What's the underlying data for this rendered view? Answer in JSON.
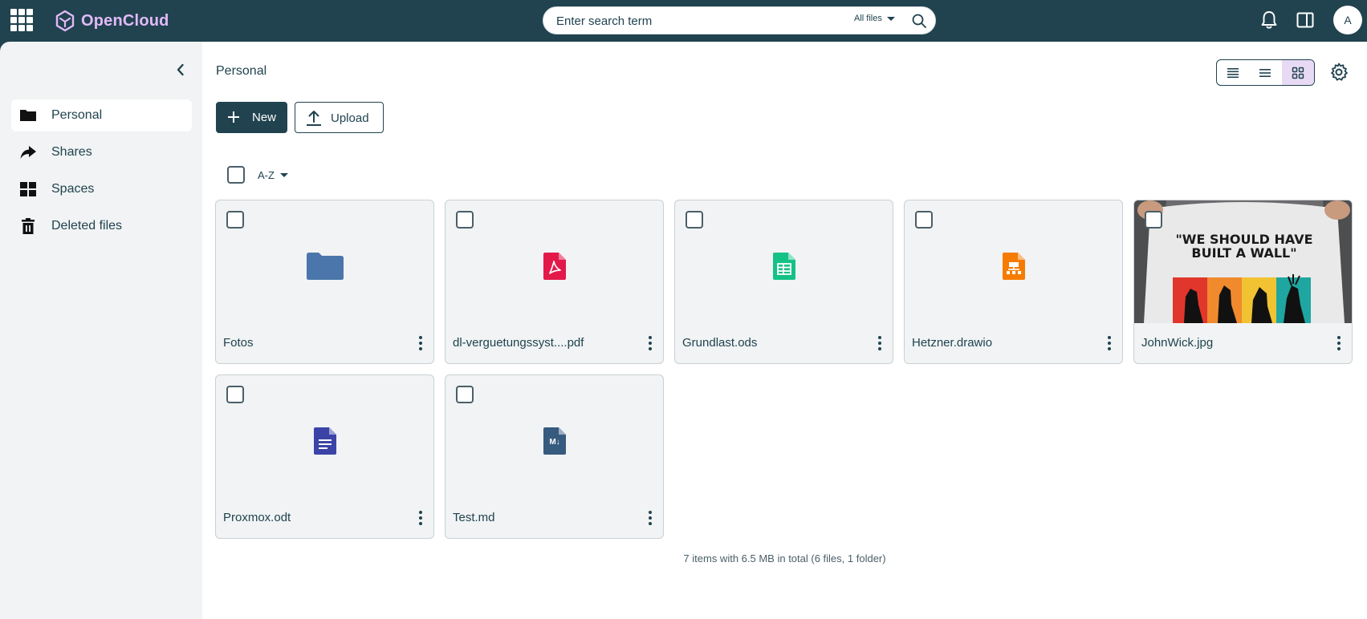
{
  "app": {
    "name": "OpenCloud",
    "brand_color": "#e2b9f7",
    "header_color": "#20434f"
  },
  "search": {
    "placeholder": "Enter search term",
    "scope": "All files"
  },
  "user": {
    "initial": "A"
  },
  "sidebar": {
    "items": [
      {
        "label": "Personal",
        "icon": "folder-icon",
        "active": true
      },
      {
        "label": "Shares",
        "icon": "share-icon",
        "active": false
      },
      {
        "label": "Spaces",
        "icon": "spaces-grid-icon",
        "active": false
      },
      {
        "label": "Deleted files",
        "icon": "trash-icon",
        "active": false
      }
    ]
  },
  "main": {
    "breadcrumb": "Personal",
    "new_label": "New",
    "upload_label": "Upload",
    "sort_label": "A-Z",
    "view_mode": "tiles",
    "files": [
      {
        "name": "Fotos",
        "type": "folder",
        "icon": "folder-icon",
        "icon_color": "#4a76ac"
      },
      {
        "name": "dl-verguetungssyst....pdf",
        "type": "pdf",
        "icon": "pdf-icon",
        "icon_color": "#e3194a"
      },
      {
        "name": "Grundlast.ods",
        "type": "spreadsheet",
        "icon": "spreadsheet-icon",
        "icon_color": "#15c286"
      },
      {
        "name": "Hetzner.drawio",
        "type": "drawio",
        "icon": "drawio-icon",
        "icon_color": "#f57c00"
      },
      {
        "name": "JohnWick.jpg",
        "type": "image",
        "icon": "image-preview",
        "preview_text": "\"WE SHOULD HAVE BUILT A WALL\""
      },
      {
        "name": "Proxmox.odt",
        "type": "document",
        "icon": "document-icon",
        "icon_color": "#3b44a6"
      },
      {
        "name": "Test.md",
        "type": "markdown",
        "icon": "markdown-icon",
        "icon_color": "#375a7f",
        "icon_text": "M↓"
      }
    ],
    "footer": "7 items with 6.5 MB in total (6 files, 1 folder)"
  }
}
